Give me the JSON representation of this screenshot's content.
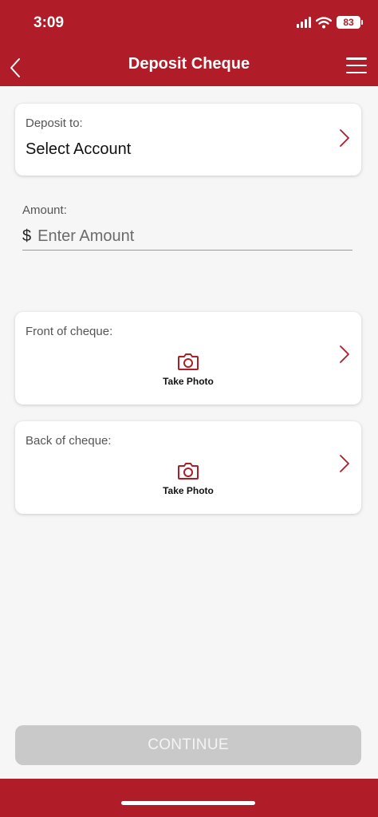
{
  "status_bar": {
    "time": "3:09",
    "battery": "83"
  },
  "header": {
    "title": "Deposit Cheque"
  },
  "deposit_to": {
    "label": "Deposit to:",
    "value": "Select Account"
  },
  "amount": {
    "label": "Amount:",
    "currency": "$",
    "placeholder": "Enter Amount"
  },
  "front": {
    "label": "Front of cheque:",
    "action": "Take Photo"
  },
  "back": {
    "label": "Back of cheque:",
    "action": "Take Photo"
  },
  "footer": {
    "continue_label": "CONTINUE"
  },
  "colors": {
    "brand": "#b01c28",
    "disabled_button": "#c9c9c9"
  },
  "icons": [
    "back-chevron-icon",
    "menu-icon",
    "chevron-right-icon",
    "camera-icon",
    "signal-icon",
    "wifi-icon",
    "battery-icon"
  ]
}
